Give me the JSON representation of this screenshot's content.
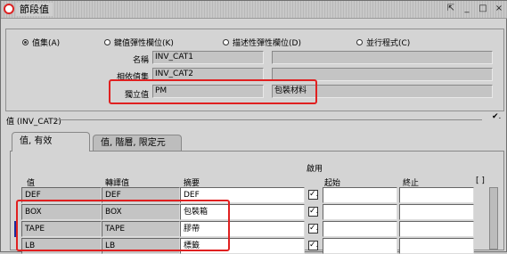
{
  "window": {
    "title": "節段值",
    "buttons": [
      "⇱",
      "_",
      "□",
      "×"
    ]
  },
  "radios": [
    {
      "label": "值集(A)",
      "selected": true
    },
    {
      "label": "鍵值彈性欄位(K)",
      "selected": false
    },
    {
      "label": "描述性彈性欄位(D)",
      "selected": false
    },
    {
      "label": "並行程式(C)",
      "selected": false
    }
  ],
  "fields": {
    "name_label": "名稱",
    "name_value": "INV_CAT1",
    "dependent_label": "相依值集",
    "dependent_value": "INV_CAT2",
    "independent_label": "獨立值",
    "independent_value": "PM",
    "independent_desc": "包裝材料"
  },
  "values_section": {
    "title": "值 (INV_CAT2)",
    "check": "✔."
  },
  "tabs": [
    {
      "label": "值, 有效",
      "active": true
    },
    {
      "label": "值, 階層, 限定元",
      "active": false
    }
  ],
  "columns": {
    "value": "值",
    "translated": "轉譯值",
    "summary": "摘要",
    "enabled": "啟用",
    "start": "起始",
    "end": "終止",
    "extra": "[ ]"
  },
  "rows": [
    {
      "value": "DEF",
      "translated": "DEF",
      "summary": "DEF",
      "enabled": "✓."
    },
    {
      "value": "BOX",
      "translated": "BOX",
      "summary": "包裝箱",
      "enabled": "✓."
    },
    {
      "value": "TAPE",
      "translated": "TAPE",
      "summary": "膠帶",
      "enabled": "✓."
    },
    {
      "value": "LB",
      "translated": "LB",
      "summary": "標籤",
      "enabled": "✓."
    }
  ],
  "colors": {
    "highlight": "#e02020",
    "current_row": "#1a2a9a"
  }
}
